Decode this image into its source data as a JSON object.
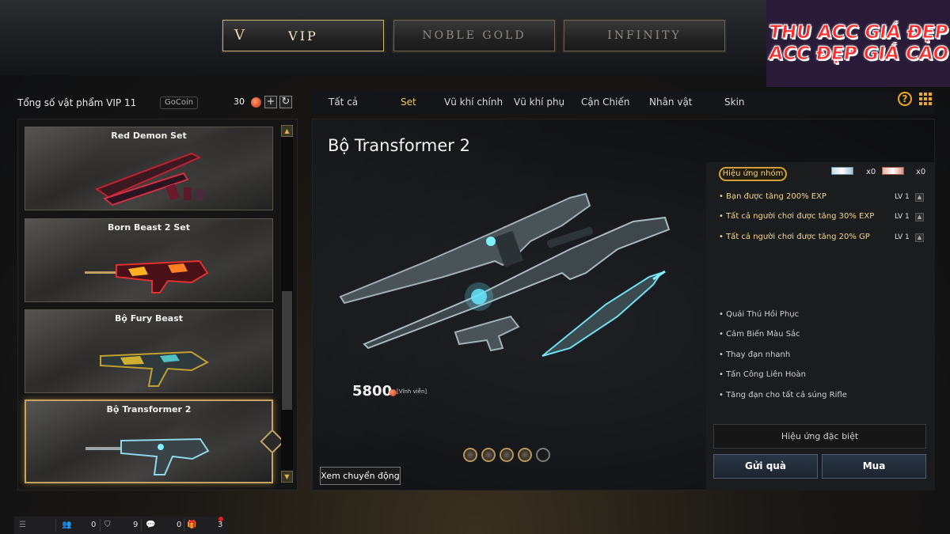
{
  "top_tabs": [
    {
      "label": "VIP",
      "mark": "V",
      "active": true
    },
    {
      "label": "NOBLE GOLD",
      "active": false
    },
    {
      "label": "INFINITY",
      "active": false
    }
  ],
  "promo": {
    "line1": "THU ACC GIÁ ĐẸP",
    "line2": "ACC ĐẸP GIÁ CAO"
  },
  "left_header": {
    "title": "Tổng số vật phẩm VIP 11",
    "gocoin": "GoCoin",
    "count": "30",
    "add_icon": "+",
    "refresh_icon": "↻"
  },
  "item_list": [
    {
      "name": "Red Demon Set"
    },
    {
      "name": "Born Beast 2 Set"
    },
    {
      "name": "Bộ Fury Beast"
    },
    {
      "name": "Bộ Transformer 2",
      "selected": true
    }
  ],
  "categories": [
    {
      "label": "Tất cả"
    },
    {
      "label": "Set",
      "active": true
    },
    {
      "label": "Vũ khí chính"
    },
    {
      "label": "Vũ khí phụ"
    },
    {
      "label": "Cận Chiến"
    },
    {
      "label": "Nhân vật"
    },
    {
      "label": "Skin"
    }
  ],
  "help_icon": "?",
  "item": {
    "title": "Bộ Transformer 2",
    "price": "5800",
    "price_note": "[Vĩnh viễn]",
    "motion_button": "Xem chuyển động"
  },
  "info": {
    "badge": "Hiệu ứng nhóm",
    "count_a": "x0",
    "count_b": "x0",
    "bonuses": [
      {
        "text": "• Bạn được tăng 200%  EXP",
        "level": "LV 1"
      },
      {
        "text": "• Tất cả người chơi được tăng 30% EXP",
        "level": "LV 1"
      },
      {
        "text": "• Tất cả người chơi được tăng 20% GP",
        "level": "LV 1"
      }
    ],
    "features": [
      "• Quái Thú Hồi Phục",
      "• Cảm Biến Màu Sắc",
      "• Thay đạn nhanh",
      "• Tấn Công Liên Hoàn",
      "• Tăng đạn cho tất cả súng Rifle"
    ],
    "special": "Hiệu ứng đặc biệt",
    "gift_button": "Gửi quà",
    "buy_button": "Mua"
  },
  "bottom_bar": {
    "count_a": "0",
    "count_b": "9",
    "count_c": "0",
    "count_d": "3"
  },
  "colors": {
    "gold_accent": "#f2c75e",
    "orange_icon": "#f0a920",
    "promo_text": "#ff2a2a",
    "button_blue": "#2a3646"
  }
}
